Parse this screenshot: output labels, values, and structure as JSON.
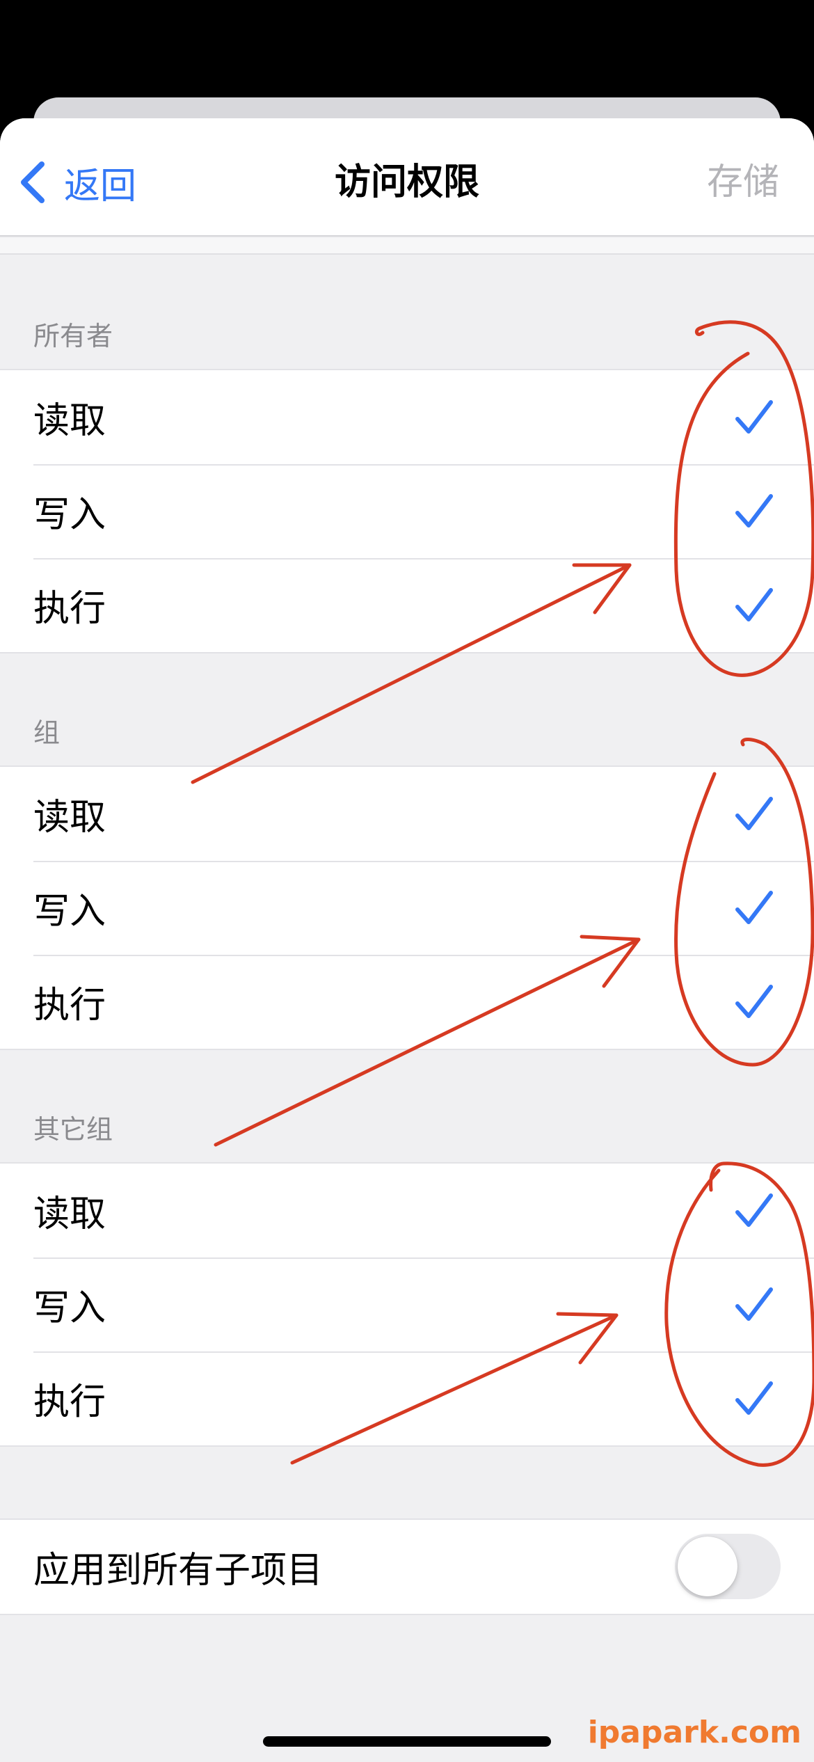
{
  "nav": {
    "back_label": "返回",
    "title": "访问权限",
    "save_label": "存储"
  },
  "sections": [
    {
      "header": "所有者",
      "rows": [
        {
          "label": "读取",
          "checked": true
        },
        {
          "label": "写入",
          "checked": true
        },
        {
          "label": "执行",
          "checked": true
        }
      ]
    },
    {
      "header": "组",
      "rows": [
        {
          "label": "读取",
          "checked": true
        },
        {
          "label": "写入",
          "checked": true
        },
        {
          "label": "执行",
          "checked": true
        }
      ]
    },
    {
      "header": "其它组",
      "rows": [
        {
          "label": "读取",
          "checked": true
        },
        {
          "label": "写入",
          "checked": true
        },
        {
          "label": "执行",
          "checked": true
        }
      ]
    }
  ],
  "apply_all": {
    "label": "应用到所有子项目",
    "enabled": false
  },
  "watermark": "ipapark.com",
  "colors": {
    "accent": "#3478f6",
    "annotation": "#d63a22",
    "disabled_text": "#b4b4b8"
  },
  "icons": {
    "back": "chevron-left-icon",
    "check": "checkmark-icon"
  }
}
